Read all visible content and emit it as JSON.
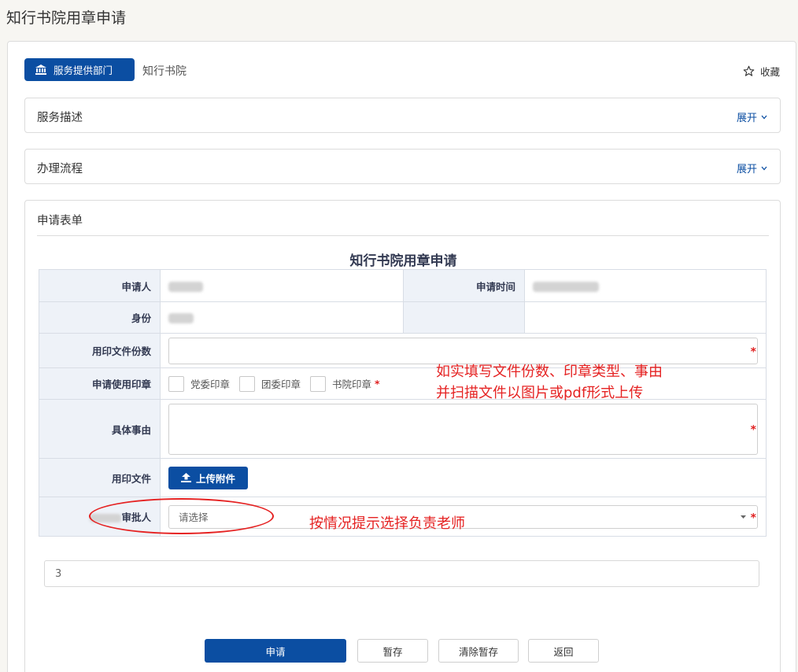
{
  "page": {
    "title": "知行书院用章申请"
  },
  "header": {
    "dept_badge": "服务提供部门",
    "dept_name": "知行书院",
    "favorite": "收藏"
  },
  "sections": [
    {
      "label": "服务描述",
      "expand": "展开"
    },
    {
      "label": "办理流程",
      "expand": "展开"
    }
  ],
  "form": {
    "header": "申请表单",
    "title": "知行书院用章申请",
    "rows": {
      "applicant": "申请人",
      "apply_time": "申请时间",
      "identity": "身份",
      "copies": "用印文件份数",
      "seal_type": "申请使用印章",
      "reason": "具体事由",
      "file": "用印文件",
      "approver": "审批人"
    },
    "seal_options": [
      "党委印章",
      "团委印章",
      "书院印章"
    ],
    "upload_label": "上传附件",
    "select_placeholder": "请选择",
    "required_mark": "*"
  },
  "annotations": {
    "note1_line1": "如实填写文件份数、印章类型、事由",
    "note1_line2": "并扫描文件以图片或pdf形式上传",
    "note2": "按情况提示选择负责老师"
  },
  "extra_field_value": "3",
  "buttons": {
    "submit": "申请",
    "save_draft": "暂存",
    "clear_draft": "清除暂存",
    "back": "返回"
  },
  "colors": {
    "primary": "#0b4ea2",
    "annotation": "#e52222",
    "label_bg": "#eef2f8"
  }
}
